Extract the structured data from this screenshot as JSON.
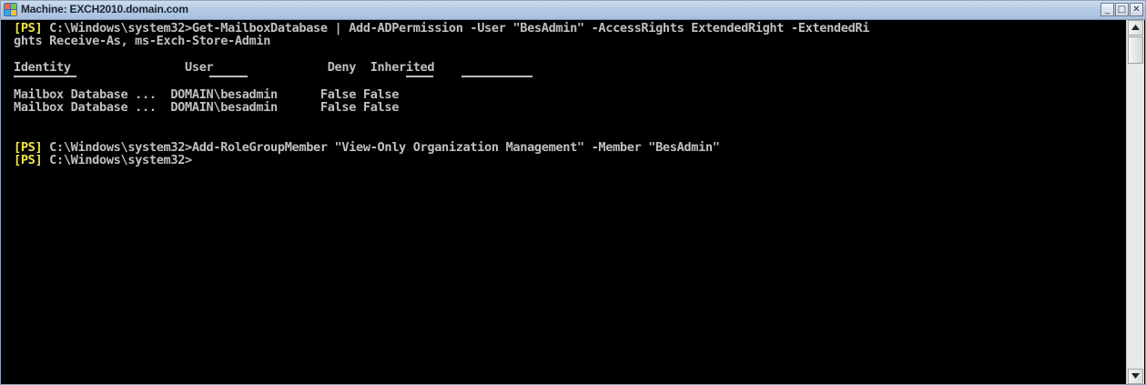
{
  "window": {
    "title": "Machine: EXCH2010.domain.com",
    "controls": {
      "minimize": "_",
      "maximize": "□",
      "close": "✕"
    }
  },
  "console": {
    "prompt_tag": "[PS]",
    "lines": {
      "cmd1_line1": " C:\\Windows\\system32>Get-MailboxDatabase | Add-ADPermission -User \"BesAdmin\" -AccessRights ExtendedRight -ExtendedRi",
      "cmd1_line2": "ghts Receive-As, ms-Exch-Store-Admin",
      "header": "Identity                User                Deny  Inherited",
      "row1": "Mailbox Database ...  DOMAIN\\besadmin      False False",
      "row2": "Mailbox Database ...  DOMAIN\\besadmin      False False",
      "cmd2": " C:\\Windows\\system32>Add-RoleGroupMember \"View-Only Organization Management\" -Member \"BesAdmin\"",
      "cmd3": " C:\\Windows\\system32>"
    }
  },
  "scrollbar": {
    "up_icon": "up-arrow",
    "down_icon": "down-arrow"
  },
  "colors": {
    "background": "#000000",
    "text": "#c0c0c0",
    "prompt_tag": "#f0e64a",
    "titlebar": "#b3c9e4"
  }
}
